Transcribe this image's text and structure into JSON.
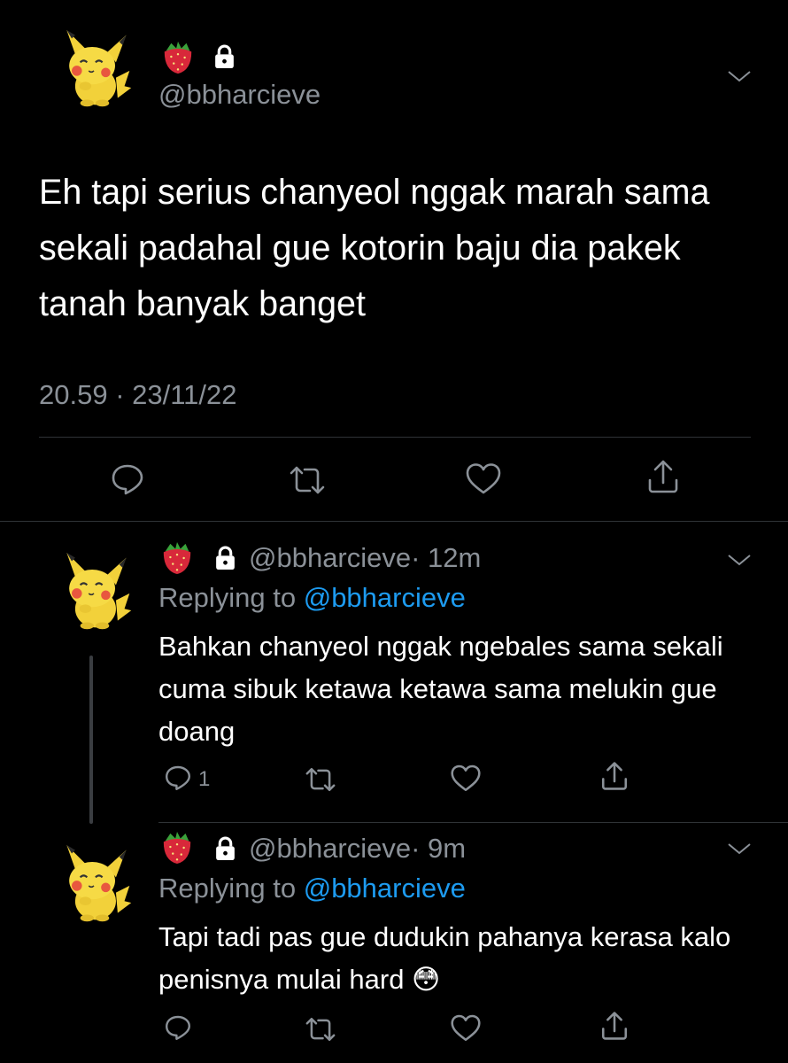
{
  "main_tweet": {
    "emoji": "🍓",
    "handle": "@bbharcieve",
    "text": "Eh tapi serius chanyeol nggak marah sama sekali padahal gue kotorin baju dia pakek tanah banyak banget",
    "timestamp": "20.59 · 23/11/22"
  },
  "replies": [
    {
      "emoji": "🍓",
      "handle": "@bbharcieve",
      "time": "· 12m",
      "replying_prefix": "Replying to",
      "replying_handle": "@bbharcieve",
      "text": "Bahkan chanyeol nggak ngebales sama sekali cuma sibuk ketawa ketawa sama melukin gue doang",
      "reply_count": "1"
    },
    {
      "emoji": "🍓",
      "handle": "@bbharcieve",
      "time": "· 9m",
      "replying_prefix": "Replying to",
      "replying_handle": "@bbharcieve",
      "text": "Tapi tadi pas gue dudukin pahanya kerasa kalo penisnya mulai hard 😳",
      "reply_count": ""
    }
  ],
  "colors": {
    "background": "#000000",
    "text": "#e7e9ea",
    "muted": "#8b9198",
    "link": "#1d9bf0",
    "divider": "#2f3336"
  },
  "icons": [
    "pikachu-avatar",
    "strawberry-emoji",
    "lock-icon",
    "chevron-down-icon",
    "reply-icon",
    "retweet-icon",
    "like-icon",
    "share-icon"
  ]
}
